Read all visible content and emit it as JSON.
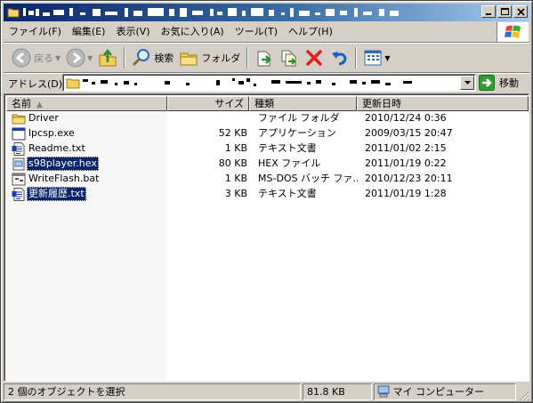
{
  "menu": {
    "items": [
      "ファイル(F)",
      "編集(E)",
      "表示(V)",
      "お気に入り(A)",
      "ツール(T)",
      "ヘルプ(H)"
    ]
  },
  "toolbar": {
    "back_label": "戻る",
    "search_label": "検索",
    "folders_label": "フォルダ"
  },
  "address": {
    "label": "アドレス(D)",
    "go_label": "移動"
  },
  "columns": {
    "name": "名前",
    "size": "サイズ",
    "type": "種類",
    "date": "更新日時"
  },
  "files": [
    {
      "name": "Driver",
      "size": "",
      "type": "ファイル フォルダ",
      "date": "2010/12/24 0:36",
      "icon": "folder-icon",
      "selected": false
    },
    {
      "name": "lpcsp.exe",
      "size": "52 KB",
      "type": "アプリケーション",
      "date": "2009/03/15 20:47",
      "icon": "application-icon",
      "selected": false
    },
    {
      "name": "Readme.txt",
      "size": "1 KB",
      "type": "テキスト文書",
      "date": "2011/01/02 2:15",
      "icon": "text-document-icon",
      "selected": false
    },
    {
      "name": "s98player.hex",
      "size": "80 KB",
      "type": "HEX ファイル",
      "date": "2011/01/19 0:22",
      "icon": "hex-file-icon",
      "selected": true
    },
    {
      "name": "WriteFlash.bat",
      "size": "1 KB",
      "type": "MS-DOS バッチ ファ...",
      "date": "2010/12/23 20:11",
      "icon": "batch-file-icon",
      "selected": false
    },
    {
      "name": "更新履歴.txt",
      "size": "3 KB",
      "type": "テキスト文書",
      "date": "2011/01/19 1:28",
      "icon": "text-document-icon",
      "selected": true
    }
  ],
  "status": {
    "selection": "2 個のオブジェクトを選択",
    "size": "81.8 KB",
    "location": "マイ コンピューター"
  },
  "colors": {
    "title_start": "#0a246a",
    "title_end": "#a6caf0",
    "selection": "#0a246a",
    "face": "#d4d0c8"
  }
}
